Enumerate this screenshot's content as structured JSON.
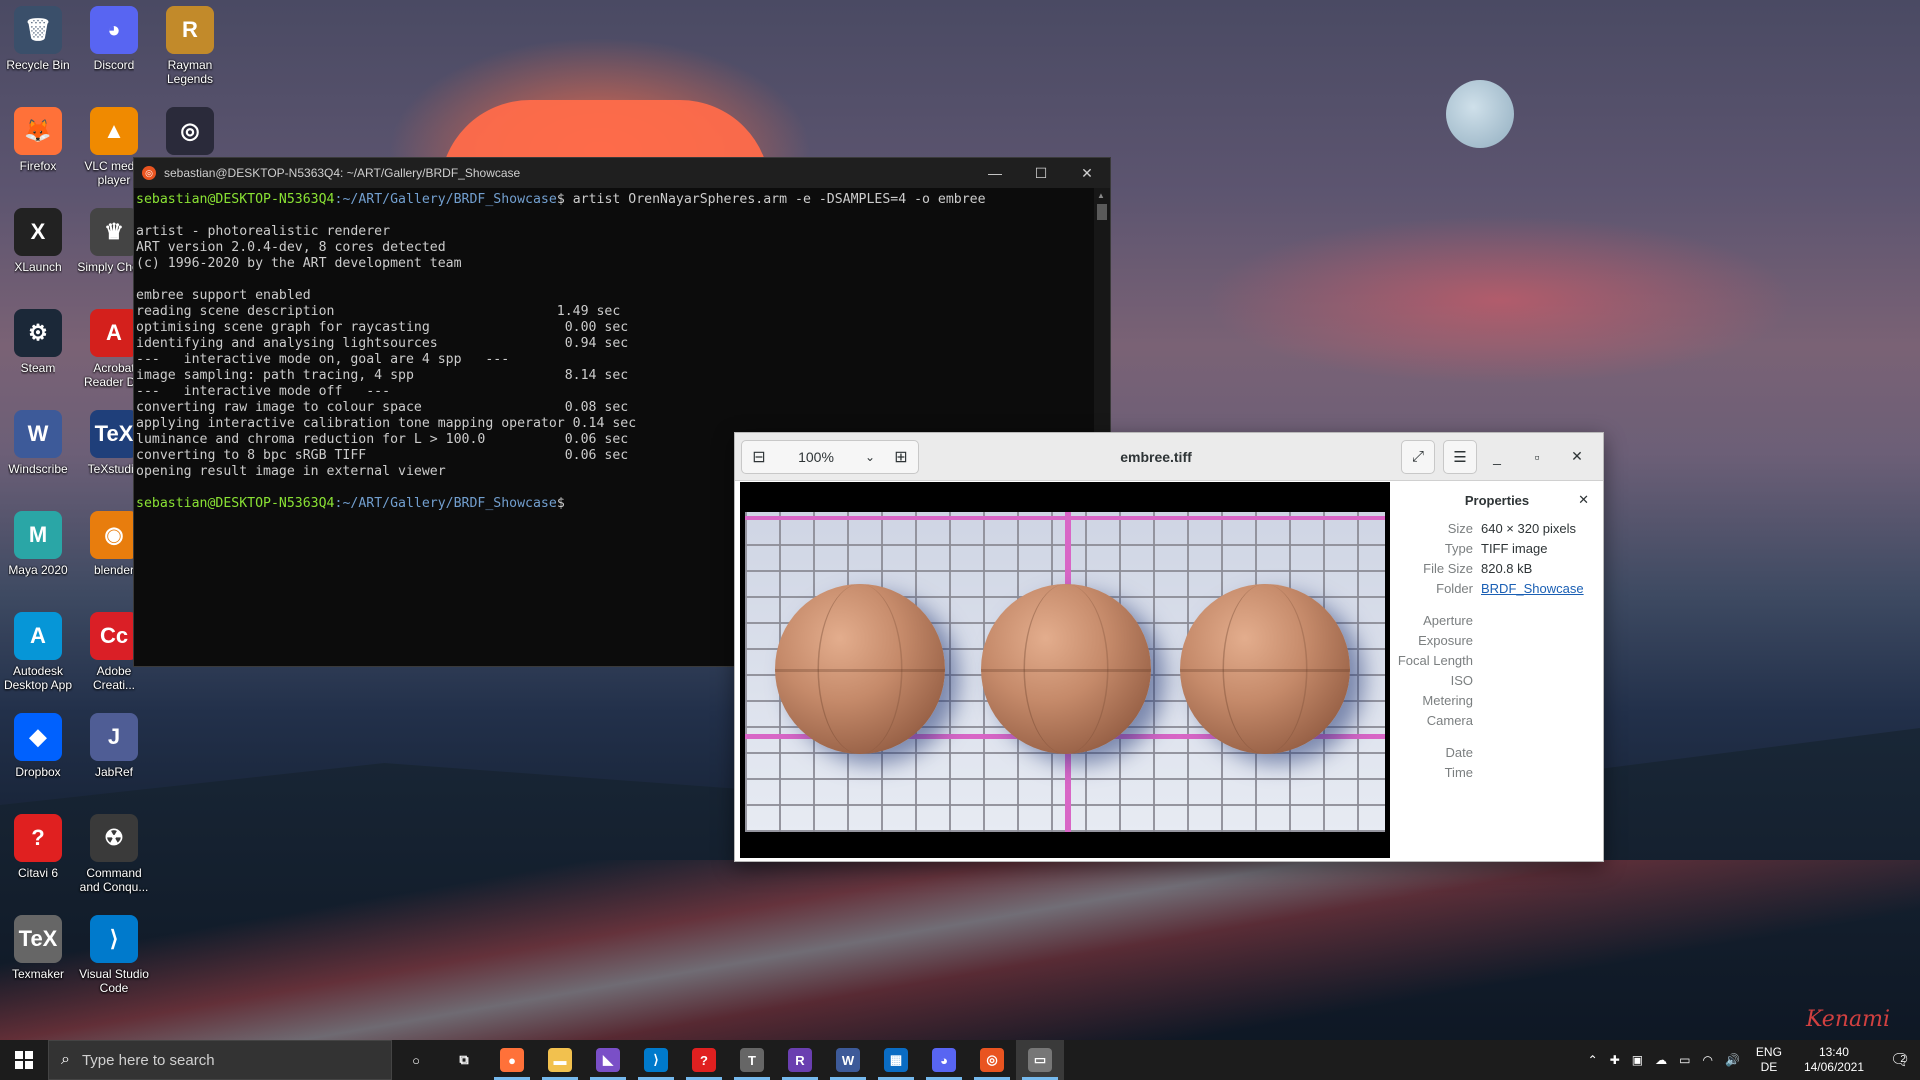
{
  "desktop": {
    "icons": [
      {
        "label": "Recycle Bin",
        "glyph": "🗑",
        "color": "#3a4f6a"
      },
      {
        "label": "Discord",
        "glyph": "◕",
        "color": "#5865f2"
      },
      {
        "label": "Rayman Legends",
        "glyph": "R",
        "color": "#c28a2a"
      },
      {
        "label": "Firefox",
        "glyph": "🦊",
        "color": "#ff7139"
      },
      {
        "label": "VLC media player",
        "glyph": "▲",
        "color": "#f08a00"
      },
      {
        "label": "",
        "glyph": "◎",
        "color": "#2a2a3a"
      },
      {
        "label": "XLaunch",
        "glyph": "X",
        "color": "#222222"
      },
      {
        "label": "Simply Chess",
        "glyph": "♛",
        "color": "#444444"
      },
      {
        "label": "Steam",
        "glyph": "⚙",
        "color": "#1b2838"
      },
      {
        "label": "Acrobat Reader DC",
        "glyph": "A",
        "color": "#d4201c"
      },
      {
        "label": "Windscribe",
        "glyph": "W",
        "color": "#3d5a99"
      },
      {
        "label": "TeXstudio",
        "glyph": "TeX",
        "color": "#1f3f7a"
      },
      {
        "label": "Maya 2020",
        "glyph": "M",
        "color": "#2aa6a6"
      },
      {
        "label": "blender",
        "glyph": "◉",
        "color": "#e87d0d"
      },
      {
        "label": "Autodesk Desktop App",
        "glyph": "A",
        "color": "#0696d7"
      },
      {
        "label": "Adobe Creati...",
        "glyph": "Cc",
        "color": "#da1f26"
      },
      {
        "label": "Dropbox",
        "glyph": "◆",
        "color": "#0061fe"
      },
      {
        "label": "JabRef",
        "glyph": "J",
        "color": "#4f5d95"
      },
      {
        "label": "Citavi 6",
        "glyph": "?",
        "color": "#e02020"
      },
      {
        "label": "Command and Conqu...",
        "glyph": "☢",
        "color": "#3a3a3a"
      },
      {
        "label": "Texmaker",
        "glyph": "TeX",
        "color": "#666666"
      },
      {
        "label": "Visual Studio Code",
        "glyph": "⟩",
        "color": "#007acc"
      }
    ],
    "signature": "Kenami"
  },
  "terminal": {
    "title": "sebastian@DESKTOP-N5363Q4: ~/ART/Gallery/BRDF_Showcase",
    "prompt_user": "sebastian@DESKTOP-N5363Q4",
    "prompt_path": ":~/ART/Gallery/BRDF_Showcase",
    "command": "$ artist OrenNayarSpheres.arm -e -DSAMPLES=4 -o embree",
    "lines": [
      "",
      "artist - photorealistic renderer",
      "ART version 2.0.4-dev, 8 cores detected",
      "(c) 1996-2020 by the ART development team",
      "",
      "embree support enabled",
      "reading scene description                            1.49 sec",
      "optimising scene graph for raycasting                 0.00 sec",
      "identifying and analysing lightsources                0.94 sec",
      "---   interactive mode on, goal are 4 spp   ---",
      "image sampling: path tracing, 4 spp                   8.14 sec",
      "---   interactive mode off   ---",
      "converting raw image to colour space                  0.08 sec",
      "applying interactive calibration tone mapping operator 0.14 sec",
      "luminance and chroma reduction for L > 100.0          0.06 sec",
      "converting to 8 bpc sRGB TIFF                         0.06 sec",
      "opening result image in external viewer",
      ""
    ],
    "final_prompt_suffix": "$"
  },
  "viewer": {
    "zoom": "100%",
    "title": "embree.tiff",
    "properties": {
      "heading": "Properties",
      "size_label": "Size",
      "size": "640 × 320 pixels",
      "type_label": "Type",
      "type": "TIFF image",
      "filesize_label": "File Size",
      "filesize": "820.8 kB",
      "folder_label": "Folder",
      "folder": "BRDF_Showcase",
      "aperture_label": "Aperture",
      "exposure_label": "Exposure",
      "focal_label": "Focal Length",
      "iso_label": "ISO",
      "metering_label": "Metering",
      "camera_label": "Camera",
      "date_label": "Date",
      "time_label": "Time"
    }
  },
  "taskbar": {
    "search_placeholder": "Type here to search",
    "apps": [
      {
        "name": "cortana",
        "glyph": "○",
        "color": "transparent"
      },
      {
        "name": "task-view",
        "glyph": "⧉",
        "color": "transparent"
      },
      {
        "name": "firefox",
        "glyph": "●",
        "color": "#ff7139"
      },
      {
        "name": "file-explorer",
        "glyph": "▬",
        "color": "#f2c14e"
      },
      {
        "name": "visual-studio",
        "glyph": "◣",
        "color": "#7a4fc7"
      },
      {
        "name": "vscode",
        "glyph": "⟩",
        "color": "#007acc"
      },
      {
        "name": "citavi",
        "glyph": "?",
        "color": "#e02020"
      },
      {
        "name": "texmaker",
        "glyph": "T",
        "color": "#666666"
      },
      {
        "name": "rayman",
        "glyph": "R",
        "color": "#6a3fb0"
      },
      {
        "name": "windscribe",
        "glyph": "W",
        "color": "#3d5a99"
      },
      {
        "name": "store",
        "glyph": "▦",
        "color": "#0a6cc4"
      },
      {
        "name": "discord",
        "glyph": "◕",
        "color": "#5865f2"
      },
      {
        "name": "ubuntu",
        "glyph": "◎",
        "color": "#e95420"
      },
      {
        "name": "image-viewer",
        "glyph": "▭",
        "color": "#777777"
      }
    ],
    "lang_top": "ENG",
    "lang_bottom": "DE",
    "time": "13:40",
    "date": "14/06/2021",
    "notification_count": "2"
  }
}
